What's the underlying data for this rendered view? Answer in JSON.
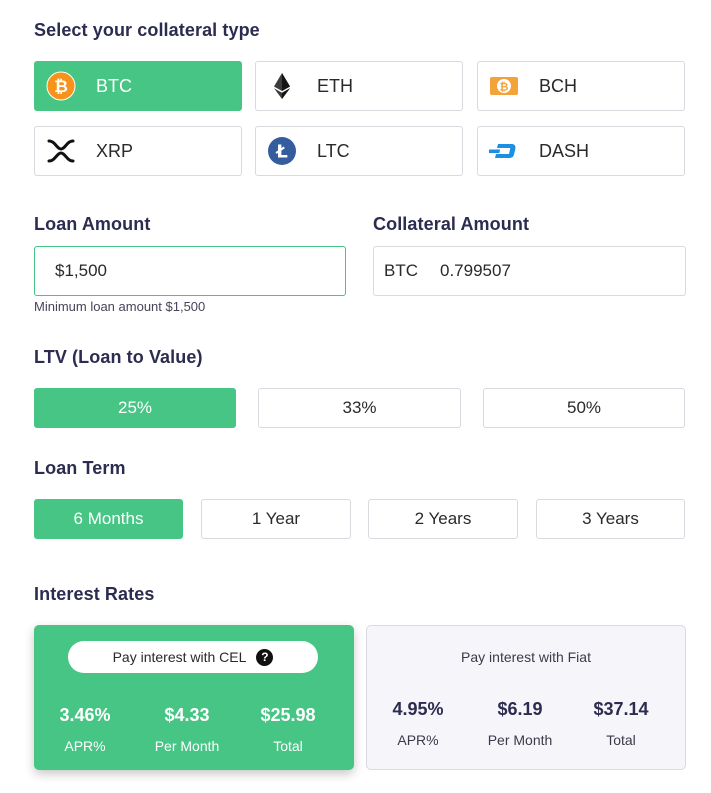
{
  "collateral": {
    "title": "Select your collateral type",
    "coins": [
      {
        "label": "BTC",
        "icon": "bitcoin-icon",
        "active": true
      },
      {
        "label": "ETH",
        "icon": "ethereum-icon",
        "active": false
      },
      {
        "label": "BCH",
        "icon": "bitcoin-cash-icon",
        "active": false
      },
      {
        "label": "XRP",
        "icon": "ripple-icon",
        "active": false
      },
      {
        "label": "LTC",
        "icon": "litecoin-icon",
        "active": false
      },
      {
        "label": "DASH",
        "icon": "dash-icon",
        "active": false
      }
    ]
  },
  "loan": {
    "title": "Loan Amount",
    "value": "$1,500",
    "hint": "Minimum loan amount $1,500"
  },
  "collateral_amount": {
    "title": "Collateral Amount",
    "currency": "BTC",
    "value": "0.799507"
  },
  "ltv": {
    "title": "LTV (Loan to Value)",
    "options": [
      "25%",
      "33%",
      "50%"
    ],
    "selected": "25%"
  },
  "term": {
    "title": "Loan Term",
    "options": [
      "6 Months",
      "1 Year",
      "2 Years",
      "3 Years"
    ],
    "selected": "6 Months"
  },
  "interest": {
    "title": "Interest Rates",
    "cel": {
      "label": "Pay interest with CEL",
      "help": "?",
      "apr": "3.46%",
      "apr_label": "APR%",
      "monthly": "$4.33",
      "monthly_label": "Per Month",
      "total": "$25.98",
      "total_label": "Total"
    },
    "fiat": {
      "label": "Pay interest with Fiat",
      "apr": "4.95%",
      "apr_label": "APR%",
      "monthly": "$6.19",
      "monthly_label": "Per Month",
      "total": "$37.14",
      "total_label": "Total"
    }
  },
  "colors": {
    "accent": "#46c584",
    "heading": "#2c2c50",
    "border": "#d9d9e0",
    "btc": "#f7931a",
    "bch": "#f2a33a",
    "ltc": "#345d9d",
    "dash": "#1c8fe3"
  }
}
